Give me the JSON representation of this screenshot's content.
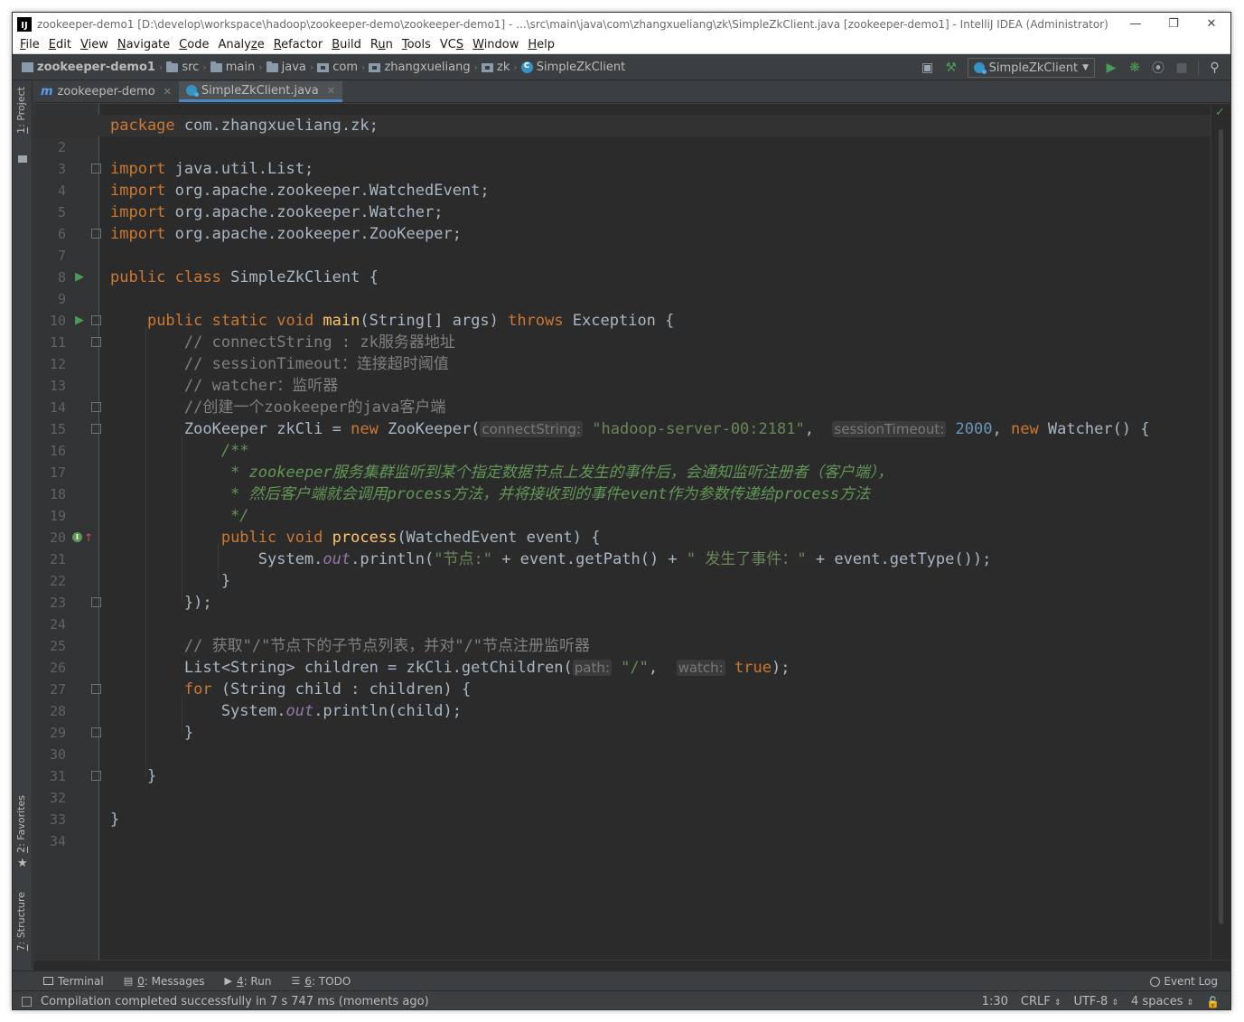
{
  "window": {
    "title": "zookeeper-demo1 [D:\\develop\\workspace\\hadoop\\zookeeper-demo\\zookeeper-demo1] - ...\\src\\main\\java\\com\\zhangxueliang\\zk\\SimpleZkClient.java [zookeeper-demo1] - IntelliJ IDEA (Administrator)"
  },
  "menu": [
    {
      "pre": "",
      "u": "F",
      "post": "ile"
    },
    {
      "pre": "",
      "u": "E",
      "post": "dit"
    },
    {
      "pre": "",
      "u": "V",
      "post": "iew"
    },
    {
      "pre": "",
      "u": "N",
      "post": "avigate"
    },
    {
      "pre": "",
      "u": "C",
      "post": "ode"
    },
    {
      "pre": "Analy",
      "u": "z",
      "post": "e"
    },
    {
      "pre": "",
      "u": "R",
      "post": "efactor"
    },
    {
      "pre": "",
      "u": "B",
      "post": "uild"
    },
    {
      "pre": "R",
      "u": "u",
      "post": "n"
    },
    {
      "pre": "",
      "u": "T",
      "post": "ools"
    },
    {
      "pre": "VC",
      "u": "S",
      "post": ""
    },
    {
      "pre": "",
      "u": "W",
      "post": "indow"
    },
    {
      "pre": "",
      "u": "H",
      "post": "elp"
    }
  ],
  "breadcrumb": [
    "zookeeper-demo1",
    "src",
    "main",
    "java",
    "com",
    "zhangxueliang",
    "zk",
    "SimpleZkClient"
  ],
  "run_config": "SimpleZkClient",
  "tabs": [
    {
      "label": "zookeeper-demo",
      "icon": "maven-module-icon"
    },
    {
      "label": "SimpleZkClient.java",
      "icon": "java-class-icon"
    }
  ],
  "left_tools": {
    "project": {
      "num": "1",
      "label": ": Project"
    },
    "favorites": {
      "num": "2",
      "label": ": Favorites"
    },
    "structure": {
      "num": "7",
      "label": ": Structure"
    }
  },
  "code_lines": [
    [
      [
        "kw",
        "package "
      ],
      [
        "p",
        "com.zhangxueliang.zk;"
      ]
    ],
    [],
    [
      [
        "kw",
        "import "
      ],
      [
        "p",
        "java.util.List;"
      ]
    ],
    [
      [
        "kw",
        "import "
      ],
      [
        "p",
        "org.apache.zookeeper.WatchedEvent;"
      ]
    ],
    [
      [
        "kw",
        "import "
      ],
      [
        "p",
        "org.apache.zookeeper.Watcher;"
      ]
    ],
    [
      [
        "kw",
        "import "
      ],
      [
        "p",
        "org.apache.zookeeper.ZooKeeper;"
      ]
    ],
    [],
    [
      [
        "kw",
        "public class "
      ],
      [
        "p",
        "SimpleZkClient {"
      ]
    ],
    [],
    [
      [
        "p",
        "    "
      ],
      [
        "kw",
        "public static void "
      ],
      [
        "fn",
        "main"
      ],
      [
        "p",
        "(String[] args) "
      ],
      [
        "kw",
        "throws "
      ],
      [
        "p",
        "Exception {"
      ]
    ],
    [
      [
        "p",
        "        "
      ],
      [
        "cmt",
        "// connectString : zk服务器地址"
      ]
    ],
    [
      [
        "p",
        "        "
      ],
      [
        "cmt",
        "// sessionTimeout：连接超时阈值"
      ]
    ],
    [
      [
        "p",
        "        "
      ],
      [
        "cmt",
        "// watcher：监听器"
      ]
    ],
    [
      [
        "p",
        "        "
      ],
      [
        "cmt",
        "//创建一个zookeeper的java客户端"
      ]
    ],
    [
      [
        "p",
        "        ZooKeeper zkCli = "
      ],
      [
        "kw",
        "new "
      ],
      [
        "p",
        "ZooKeeper("
      ],
      [
        "hint",
        "connectString:"
      ],
      [
        "p",
        " "
      ],
      [
        "str",
        "\"hadoop-server-00:2181\""
      ],
      [
        "p",
        ",  "
      ],
      [
        "hint",
        "sessionTimeout:"
      ],
      [
        "p",
        " "
      ],
      [
        "num",
        "2000"
      ],
      [
        "p",
        ", "
      ],
      [
        "kw",
        "new "
      ],
      [
        "p",
        "Watcher() {"
      ]
    ],
    [
      [
        "p",
        "            "
      ],
      [
        "doc",
        "/**"
      ]
    ],
    [
      [
        "p",
        "             "
      ],
      [
        "doc",
        "* zookeeper服务集群监听到某个指定数据节点上发生的事件后，会通知监听注册者（客户端），"
      ]
    ],
    [
      [
        "p",
        "             "
      ],
      [
        "doc",
        "* 然后客户端就会调用process方法，并将接收到的事件event作为参数传递给process方法"
      ]
    ],
    [
      [
        "p",
        "             "
      ],
      [
        "doc",
        "*/"
      ]
    ],
    [
      [
        "p",
        "            "
      ],
      [
        "kw",
        "public void "
      ],
      [
        "fn",
        "process"
      ],
      [
        "p",
        "(WatchedEvent event) {"
      ]
    ],
    [
      [
        "p",
        "                System."
      ],
      [
        "st",
        "out"
      ],
      [
        "p",
        ".println("
      ],
      [
        "str",
        "\"节点:\""
      ],
      [
        "p",
        " + event.getPath() + "
      ],
      [
        "str",
        "\" 发生了事件：\""
      ],
      [
        "p",
        " + event.getType());"
      ]
    ],
    [
      [
        "p",
        "            }"
      ]
    ],
    [
      [
        "p",
        "        });"
      ]
    ],
    [],
    [
      [
        "p",
        "        "
      ],
      [
        "cmt",
        "// 获取\"/\"节点下的子节点列表，并对\"/\"节点注册监听器"
      ]
    ],
    [
      [
        "p",
        "        List<String> children = zkCli.getChildren("
      ],
      [
        "hint",
        "path:"
      ],
      [
        "p",
        " "
      ],
      [
        "str",
        "\"/\""
      ],
      [
        "p",
        ",  "
      ],
      [
        "hint",
        "watch:"
      ],
      [
        "p",
        " "
      ],
      [
        "kw",
        "true"
      ],
      [
        "p",
        ");"
      ]
    ],
    [
      [
        "p",
        "        "
      ],
      [
        "kw",
        "for "
      ],
      [
        "p",
        "(String child : children) {"
      ]
    ],
    [
      [
        "p",
        "            System."
      ],
      [
        "st",
        "out"
      ],
      [
        "p",
        ".println(child);"
      ]
    ],
    [
      [
        "p",
        "        }"
      ]
    ],
    [],
    [
      [
        "p",
        "    }"
      ]
    ],
    [],
    [
      [
        "p",
        "}"
      ]
    ],
    []
  ],
  "bottom_tabs": [
    {
      "num": "",
      "label": "Terminal",
      "icon": "terminal-icon"
    },
    {
      "num": "0",
      "label": ": Messages",
      "icon": "messages-icon"
    },
    {
      "num": "4",
      "label": ": Run",
      "icon": "run-icon"
    },
    {
      "num": "6",
      "label": ": TODO",
      "icon": "todo-icon"
    }
  ],
  "event_log": "Event Log",
  "status": {
    "message": "Compilation completed successfully in 7 s 747 ms (moments ago)",
    "position": "1:30",
    "line_sep": "CRLF",
    "encoding": "UTF-8",
    "indent": "4 spaces"
  },
  "colors": {
    "keyword": "#cc7832",
    "string": "#6a8759",
    "number": "#6897bb",
    "comment": "#808080",
    "doc": "#629755",
    "function": "#ffc66d",
    "background": "#2b2b2b"
  }
}
